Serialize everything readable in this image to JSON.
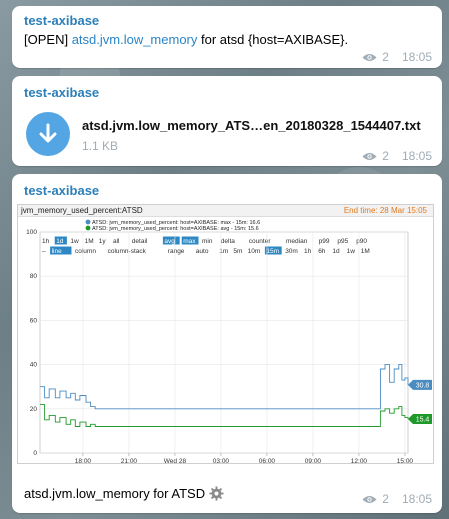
{
  "messages": [
    {
      "sender": "test-axibase",
      "prefix": "[OPEN] ",
      "link": "atsd.jvm.low_memory",
      "suffix": " for atsd {host=AXIBASE}.",
      "views": "2",
      "time": "18:05"
    },
    {
      "sender": "test-axibase",
      "file_name": "atsd.jvm.low_memory_ATS…en_20180328_1544407.txt",
      "file_size": "1.1 KB",
      "views": "2",
      "time": "18:05"
    },
    {
      "sender": "test-axibase",
      "caption": "atsd.jvm.low_memory for ATSD",
      "views": "2",
      "time": "18:05"
    }
  ],
  "icons": {
    "file": "download-arrow-icon",
    "views": "eye-icon",
    "caption": "gear-icon"
  },
  "colors": {
    "sender": "#2c7fb8",
    "link": "#2a84c6",
    "file_icon_bg": "#54a5e4",
    "max_series": "#4a8bc2",
    "avg_series": "#1f9a2a",
    "end_time": "#e07a1f"
  },
  "chart_panel": {
    "title": "jvm_memory_used_percent:ATSD",
    "end_time": "End time: 28 Mar 15:05",
    "toolbar_row1": [
      "1h",
      "1d",
      "1w",
      "1M",
      "1y",
      "all",
      "detail",
      "avg",
      "max",
      "min",
      "delta",
      "counter",
      "median",
      "p99",
      "p95",
      "p90"
    ],
    "toolbar_row2": [
      "–",
      "line",
      "column",
      "column-stack",
      "range",
      "auto",
      "1m",
      "5m",
      "10m",
      "15m",
      "30m",
      "1h",
      "6h",
      "1d",
      "1w",
      "1M"
    ],
    "active_row1": [
      "1d",
      "avg",
      "max"
    ],
    "active_row2": [
      "line",
      "15m"
    ]
  },
  "chart_data": {
    "type": "line",
    "title": "jvm_memory_used_percent:ATSD",
    "xlabel": "",
    "ylabel": "",
    "ylim": [
      0,
      100
    ],
    "yticks": [
      0,
      20,
      40,
      60,
      80,
      100
    ],
    "x_tick_labels": [
      "18:00",
      "21:00",
      "Wed 28",
      "03:00",
      "06:00",
      "09:00",
      "12:00",
      "15:00"
    ],
    "x_ticks_hours": [
      2.8,
      5.8,
      8.8,
      11.8,
      14.8,
      17.8,
      20.8,
      23.8
    ],
    "x_range_hours": [
      0,
      24
    ],
    "grid": true,
    "legend_position": "top",
    "series": [
      {
        "name": "ATSD: jvm_memory_used_percent: host=AXIBASE: max - 15m: 16.6",
        "color": "#4a8bc2",
        "last_value_label": "30.8",
        "points": [
          [
            0,
            30
          ],
          [
            0.3,
            25
          ],
          [
            0.6,
            29
          ],
          [
            1.0,
            25
          ],
          [
            1.3,
            28
          ],
          [
            1.7,
            25
          ],
          [
            2.0,
            27
          ],
          [
            2.3,
            24
          ],
          [
            2.6,
            26
          ],
          [
            3.0,
            23
          ],
          [
            3.3,
            21
          ],
          [
            3.6,
            20
          ],
          [
            22.1,
            20
          ],
          [
            22.2,
            38
          ],
          [
            22.5,
            40
          ],
          [
            22.8,
            32
          ],
          [
            23.1,
            38
          ],
          [
            23.4,
            40
          ],
          [
            23.6,
            33
          ],
          [
            23.8,
            34
          ],
          [
            24.0,
            30.8
          ]
        ]
      },
      {
        "name": "ATSD: jvm_memory_used_percent: host=AXIBASE: avg - 15m: 15.6",
        "color": "#1f9a2a",
        "last_value_label": "15.4",
        "points": [
          [
            0,
            22
          ],
          [
            0.3,
            15
          ],
          [
            0.6,
            17
          ],
          [
            1.0,
            14
          ],
          [
            1.3,
            16
          ],
          [
            1.7,
            13
          ],
          [
            2.0,
            15
          ],
          [
            2.3,
            12
          ],
          [
            2.6,
            14
          ],
          [
            3.0,
            12
          ],
          [
            3.3,
            13
          ],
          [
            3.6,
            12
          ],
          [
            22.1,
            12
          ],
          [
            22.2,
            19
          ],
          [
            22.5,
            20
          ],
          [
            22.8,
            18
          ],
          [
            23.1,
            20
          ],
          [
            23.4,
            21
          ],
          [
            23.6,
            17
          ],
          [
            23.8,
            16
          ],
          [
            24.0,
            15.4
          ]
        ]
      }
    ]
  }
}
